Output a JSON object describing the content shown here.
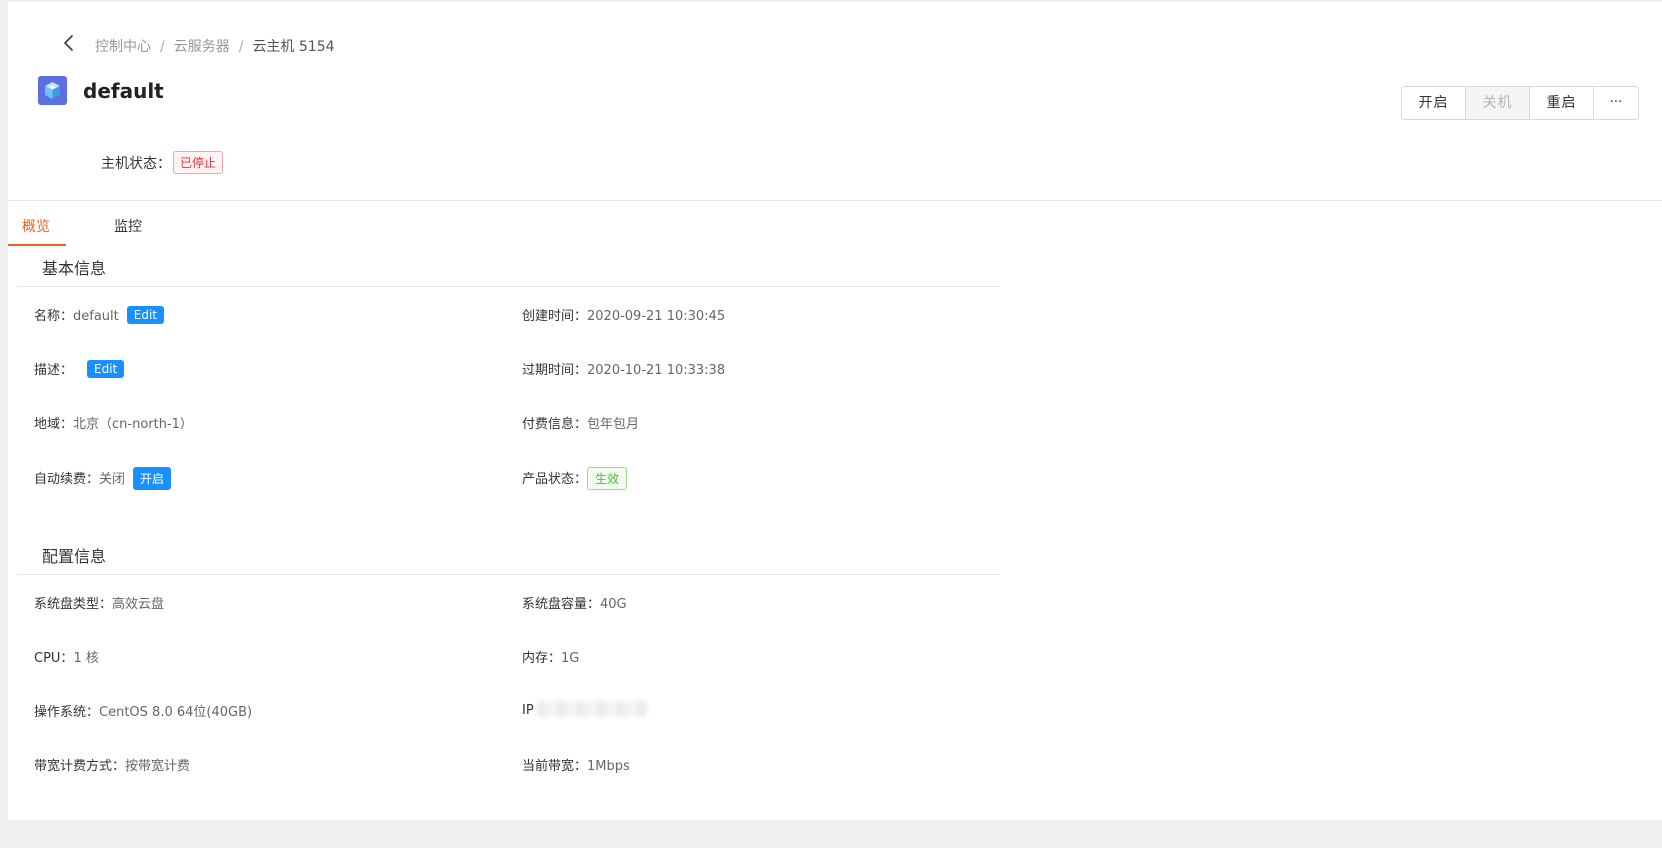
{
  "breadcrumb": {
    "items": [
      "控制中心",
      "云服务器",
      "云主机 5154"
    ],
    "separator": "/"
  },
  "header": {
    "title": "default",
    "status_label": "主机状态：",
    "status_value": "已停止",
    "actions": {
      "start": "开启",
      "shutdown": "关机",
      "restart": "重启",
      "more": "···"
    }
  },
  "tabs": [
    {
      "label": "概览",
      "active": true
    },
    {
      "label": "监控",
      "active": false
    }
  ],
  "basic": {
    "title": "基本信息",
    "name_label": "名称：",
    "name_value": "default",
    "edit_label": "Edit",
    "created_label": "创建时间：",
    "created_value": "2020-09-21 10:30:45",
    "desc_label": "描述：",
    "expire_label": "过期时间：",
    "expire_value": "2020-10-21 10:33:38",
    "region_label": "地域：",
    "region_value": "北京（cn-north-1）",
    "billing_label": "付费信息：",
    "billing_value": "包年包月",
    "renew_label": "自动续费：",
    "renew_value": "关闭",
    "renew_button": "开启",
    "product_label": "产品状态：",
    "product_value": "生效"
  },
  "config": {
    "title": "配置信息",
    "disk_type_label": "系统盘类型：",
    "disk_type_value": "高效云盘",
    "disk_size_label": "系统盘容量：",
    "disk_size_value": "40G",
    "cpu_label": "CPU：",
    "cpu_value": "1 核",
    "mem_label": "内存：",
    "mem_value": "1G",
    "os_label": "操作系统：",
    "os_value": "CentOS 8.0 64位(40GB)",
    "ip_label": "IP",
    "bw_billing_label": "带宽计费方式：",
    "bw_billing_value": "按带宽计费",
    "bw_label": "当前带宽：",
    "bw_value": "1Mbps"
  },
  "colors": {
    "accent": "#e86425",
    "primary": "#1890ff",
    "danger": "#e8323c",
    "success": "#4bbf2e"
  }
}
